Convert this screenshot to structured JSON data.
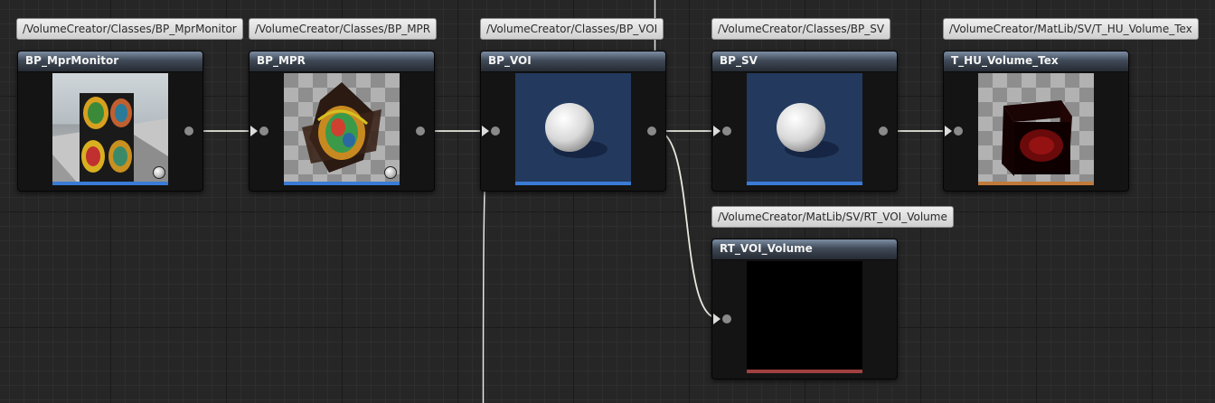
{
  "nodes": [
    {
      "title": "BP_MprMonitor",
      "path": "/VolumeCreator/Classes/BP_MprMonitor",
      "thumb_bar_color": "#3a7bd5",
      "thumb_icon": "mpr-monitor-thumbnail"
    },
    {
      "title": "BP_MPR",
      "path": "/VolumeCreator/Classes/BP_MPR",
      "thumb_bar_color": "#3a7bd5",
      "thumb_icon": "mpr-planes-thumbnail"
    },
    {
      "title": "BP_VOI",
      "path": "/VolumeCreator/Classes/BP_VOI",
      "thumb_bar_color": "#3a7bd5",
      "thumb_icon": "sphere-thumbnail"
    },
    {
      "title": "BP_SV",
      "path": "/VolumeCreator/Classes/BP_SV",
      "thumb_bar_color": "#3a7bd5",
      "thumb_icon": "sphere-thumbnail"
    },
    {
      "title": "T_HU_Volume_Tex",
      "path": "/VolumeCreator/MatLib/SV/T_HU_Volume_Tex",
      "thumb_bar_color": "#c07a3a",
      "thumb_icon": "volume-texture-thumbnail"
    },
    {
      "title": "RT_VOI_Volume",
      "path": "/VolumeCreator/MatLib/SV/RT_VOI_Volume",
      "thumb_bar_color": "#a04040",
      "thumb_icon": "render-target-thumbnail"
    }
  ],
  "colors": {
    "graph_background": "#262626",
    "wire": "#e8e8e0",
    "node_body": "#141414"
  }
}
